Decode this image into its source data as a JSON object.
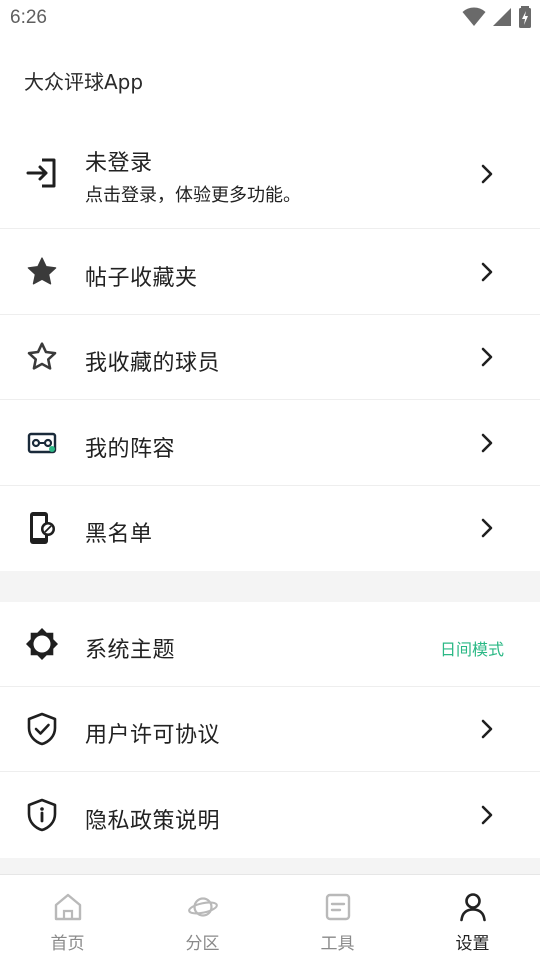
{
  "status_bar": {
    "time": "6:26"
  },
  "app_title": "大众评球App",
  "login": {
    "title": "未登录",
    "subtitle": "点击登录，体验更多功能。"
  },
  "menu_section_1": [
    {
      "label": "帖子收藏夹",
      "icon": "star-filled-icon"
    },
    {
      "label": "我收藏的球员",
      "icon": "star-outline-icon"
    },
    {
      "label": "我的阵容",
      "icon": "lineup-icon"
    },
    {
      "label": "黑名单",
      "icon": "phone-block-icon"
    }
  ],
  "menu_section_2": [
    {
      "label": "系统主题",
      "value": "日间模式",
      "icon": "brightness-icon"
    },
    {
      "label": "用户许可协议",
      "icon": "shield-check-icon"
    },
    {
      "label": "隐私政策说明",
      "icon": "shield-info-icon"
    }
  ],
  "bottom_nav": [
    {
      "label": "首页",
      "icon": "home-icon",
      "active": false
    },
    {
      "label": "分区",
      "icon": "planet-icon",
      "active": false
    },
    {
      "label": "工具",
      "icon": "tool-icon",
      "active": false
    },
    {
      "label": "设置",
      "icon": "person-icon",
      "active": true
    }
  ],
  "colors": {
    "accent": "#2bb885",
    "icon_dark": "#1f1f1f",
    "nav_inactive": "#8a8a8a",
    "section_gap": "#f4f4f4"
  }
}
